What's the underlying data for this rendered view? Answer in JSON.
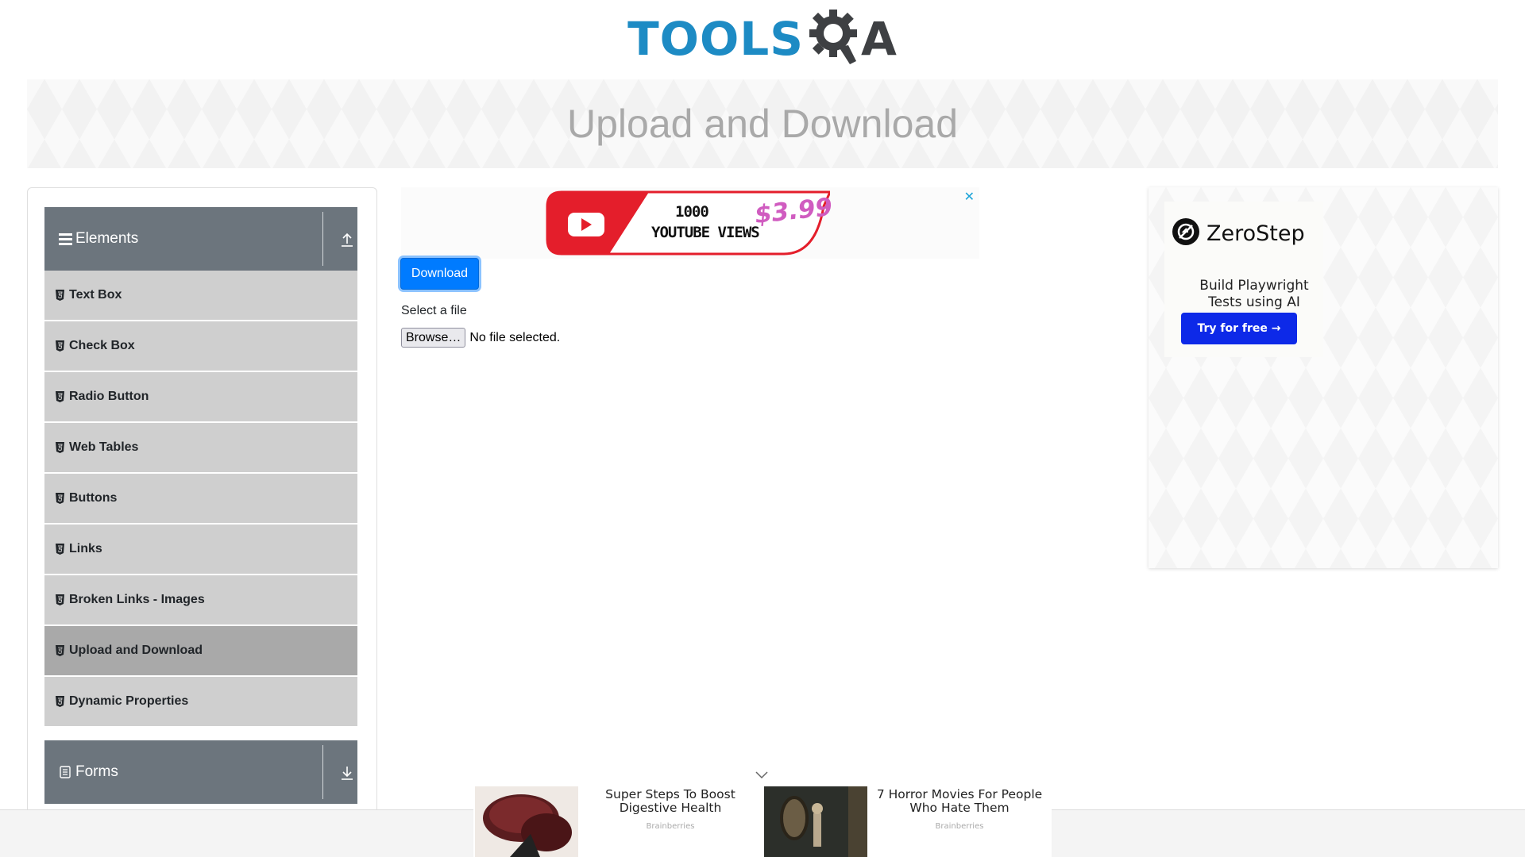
{
  "header": {
    "logo_tools": "TOOLS",
    "logo_qa": "A"
  },
  "banner": {
    "title": "Upload and Download"
  },
  "sidebar": {
    "elements_group": {
      "title": "Elements",
      "items": [
        {
          "label": "Text Box"
        },
        {
          "label": "Check Box"
        },
        {
          "label": "Radio Button"
        },
        {
          "label": "Web Tables"
        },
        {
          "label": "Buttons"
        },
        {
          "label": "Links"
        },
        {
          "label": "Broken Links - Images"
        },
        {
          "label": "Upload and Download",
          "active": true
        },
        {
          "label": "Dynamic Properties"
        }
      ]
    },
    "forms_group": {
      "title": "Forms"
    }
  },
  "main": {
    "top_ad": {
      "close": "✕",
      "line1": "1000",
      "line2": "YOUTUBE VIEWS",
      "price": "$3.99"
    },
    "download_button": "Download",
    "upload_label": "Select a file",
    "browse_button": "Browse…",
    "file_status": "No file selected."
  },
  "right_ad": {
    "brand": "ZeroStep",
    "tagline_line1": "Build Playwright",
    "tagline_line2": "Tests using AI",
    "cta": "Try for free →"
  },
  "bottom_ad": {
    "items": [
      {
        "title": "Super Steps To Boost Digestive Health",
        "source": "Brainberries"
      },
      {
        "title": "7 Horror Movies For People Who Hate Them",
        "source": "Brainberries"
      }
    ]
  },
  "colors": {
    "accent": "#007bff",
    "sidebar_header": "#6c757d",
    "menu_item": "#cfcfcf",
    "menu_item_active": "#a9a9a9",
    "logo_blue": "#1d8bc4",
    "logo_dark": "#3e4043"
  }
}
